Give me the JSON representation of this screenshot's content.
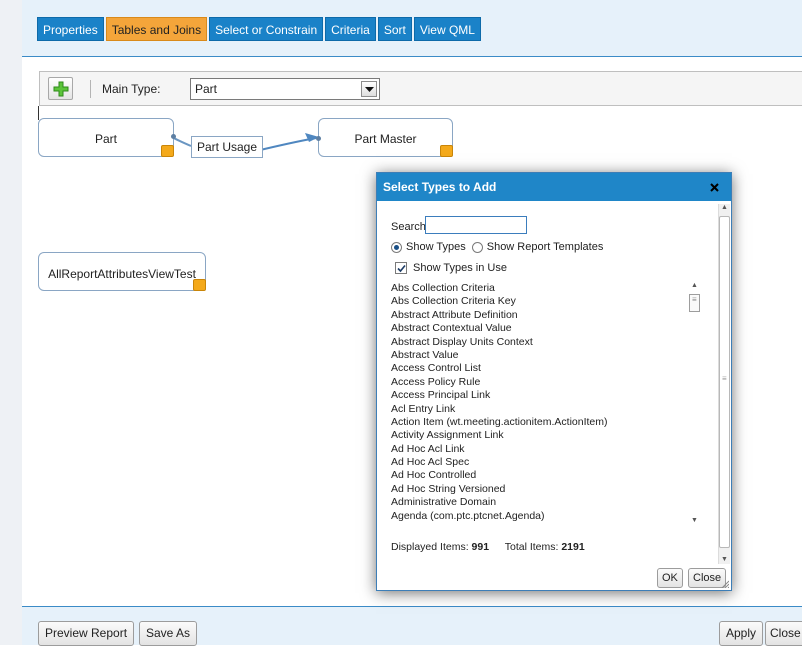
{
  "tabs": [
    {
      "label": "Properties",
      "active": false
    },
    {
      "label": "Tables and Joins",
      "active": true
    },
    {
      "label": "Select or Constrain",
      "active": false
    },
    {
      "label": "Criteria",
      "active": false
    },
    {
      "label": "Sort",
      "active": false
    },
    {
      "label": "View QML",
      "active": false
    }
  ],
  "toolbar": {
    "add_icon": "plus-icon",
    "main_type_label": "Main Type:",
    "main_type_value": "Part",
    "dropdown_icon": "chevron-down-icon"
  },
  "canvas": {
    "nodes": {
      "part": "Part",
      "part_master": "Part Master",
      "report_view": "AllReportAttributesViewTest"
    },
    "join_label": "Part Usage"
  },
  "dialog": {
    "title": "Select Types to Add",
    "close_icon": "close-icon",
    "search_label": "Search:",
    "search_value": "",
    "radio_show_types": "Show Types",
    "radio_show_templates": "Show Report Templates",
    "checkbox_label": "Show Types in Use",
    "checkbox_checked": true,
    "types": [
      "Abs Collection Criteria",
      "Abs Collection Criteria Key",
      "Abstract Attribute Definition",
      "Abstract Contextual Value",
      "Abstract Display Units Context",
      "Abstract Value",
      "Access Control List",
      "Access Policy Rule",
      "Access Principal Link",
      "Acl Entry Link",
      "Action Item (wt.meeting.actionitem.ActionItem)",
      "Activity Assignment Link",
      "Ad Hoc Acl Link",
      "Ad Hoc Acl Spec",
      "Ad Hoc Controlled",
      "Ad Hoc String Versioned",
      "Administrative Domain",
      "Agenda (com.ptc.ptcnet.Agenda)"
    ],
    "displayed_label": "Displayed Items:",
    "displayed_count": "991",
    "total_label": "Total Items:",
    "total_count": "2191",
    "ok_label": "OK",
    "close_label": "Close"
  },
  "bottom": {
    "preview_label": "Preview Report",
    "save_as_label": "Save As",
    "apply_label": "Apply",
    "close_label": "Close"
  },
  "colors": {
    "tab_blue": "#1a82c8",
    "tab_active_orange": "#f4a53a",
    "dialog_title_blue": "#1f86c8",
    "node_handle_orange": "#f4a91a"
  }
}
